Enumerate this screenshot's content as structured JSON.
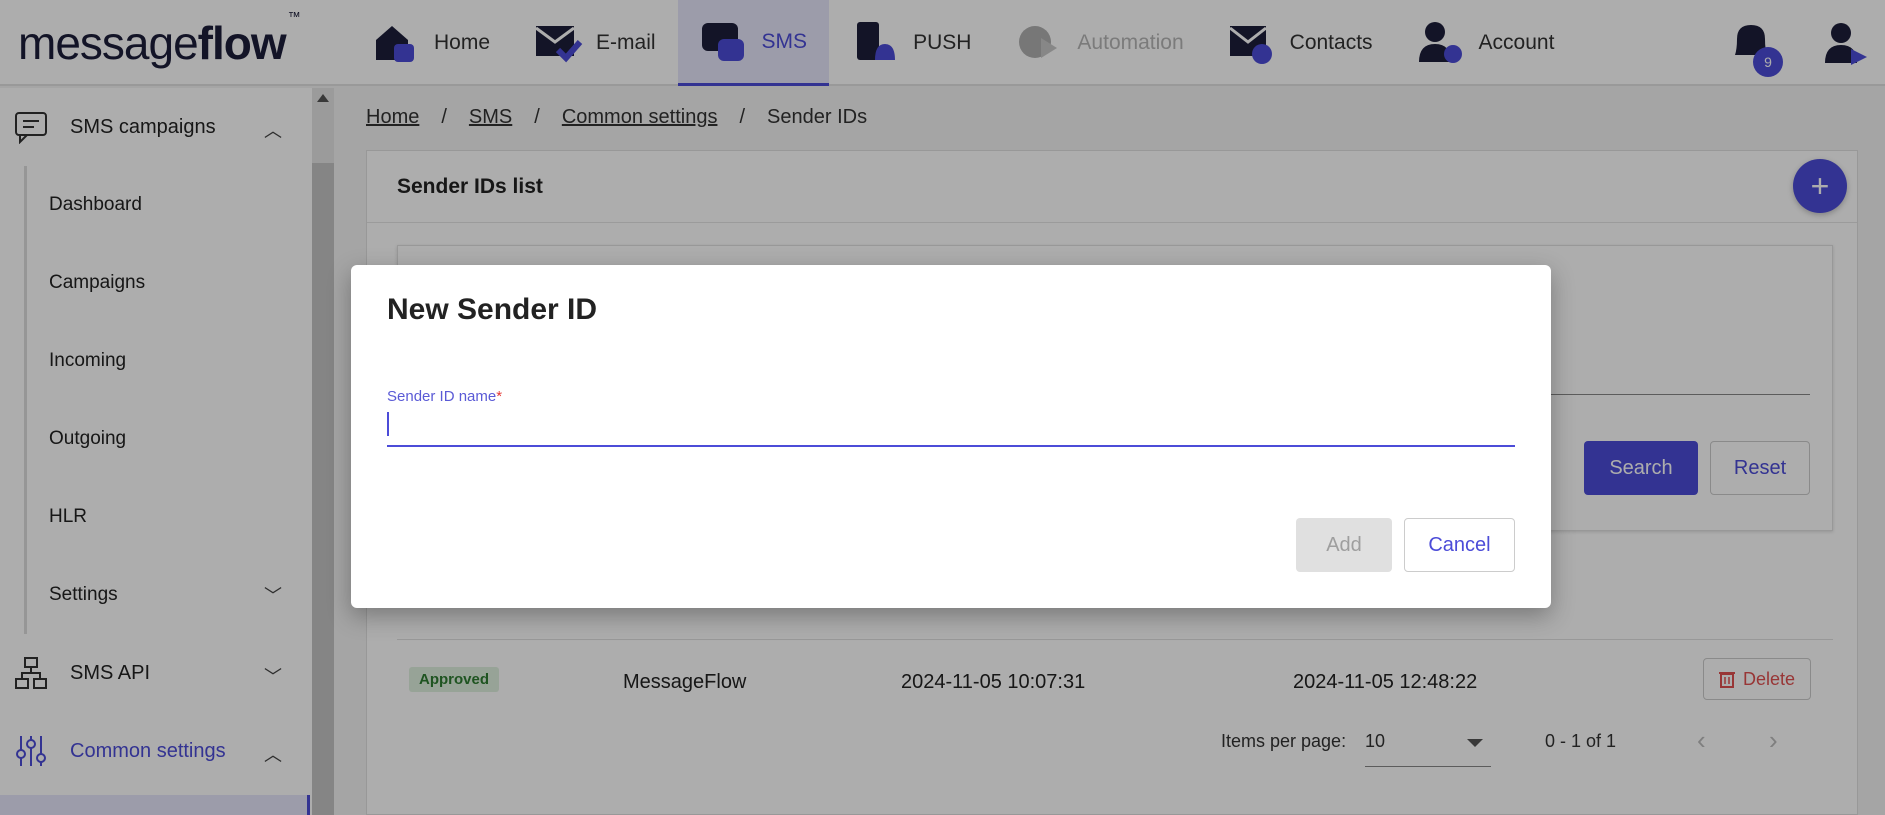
{
  "logo": {
    "brand_light": "message",
    "brand_bold": "flow",
    "tm": "™"
  },
  "nav": [
    {
      "label": "Home",
      "icon": "home-icon"
    },
    {
      "label": "E-mail",
      "icon": "email-icon"
    },
    {
      "label": "SMS",
      "icon": "sms-icon",
      "active": true
    },
    {
      "label": "PUSH",
      "icon": "push-icon"
    },
    {
      "label": "Automation",
      "icon": "automation-icon",
      "disabled": true
    },
    {
      "label": "Contacts",
      "icon": "contacts-icon"
    },
    {
      "label": "Account",
      "icon": "account-icon"
    }
  ],
  "notifications": {
    "count": "9"
  },
  "sidebar": {
    "section1": {
      "label": "SMS campaigns",
      "chevron": "︿"
    },
    "items": [
      {
        "label": "Dashboard"
      },
      {
        "label": "Campaigns"
      },
      {
        "label": "Incoming"
      },
      {
        "label": "Outgoing"
      },
      {
        "label": "HLR"
      },
      {
        "label": "Settings",
        "chevron": "﹀"
      }
    ],
    "section2": {
      "label": "SMS API",
      "chevron": "﹀"
    },
    "section3": {
      "label": "Common settings",
      "chevron": "︿"
    }
  },
  "breadcrumb": [
    {
      "label": "Home",
      "link": true
    },
    {
      "sep": "/"
    },
    {
      "label": "SMS",
      "link": true
    },
    {
      "sep": "/"
    },
    {
      "label": "Common settings",
      "link": true
    },
    {
      "sep": "/"
    },
    {
      "label": "Sender IDs",
      "link": false
    }
  ],
  "card": {
    "title": "Sender IDs list",
    "add_symbol": "+"
  },
  "filters": {
    "search_label": "Search",
    "reset_label": "Reset"
  },
  "table": {
    "rows": [
      {
        "status": "Approved",
        "name": "MessageFlow",
        "created": "2024-11-05 10:07:31",
        "updated": "2024-11-05 12:48:22",
        "action": "Delete"
      }
    ]
  },
  "pager": {
    "label": "Items per page:",
    "per_page": "10",
    "range": "0 - 1 of 1",
    "prev": "‹",
    "next": "›"
  },
  "dialog": {
    "title": "New Sender ID",
    "field_label": "Sender ID name",
    "required_mark": "*",
    "field_value": "",
    "add_label": "Add",
    "cancel_label": "Cancel"
  },
  "colors": {
    "accent": "#4c4cd8",
    "danger": "#e05050",
    "approved_bg": "#dff1df",
    "approved_text": "#2e7d32"
  }
}
